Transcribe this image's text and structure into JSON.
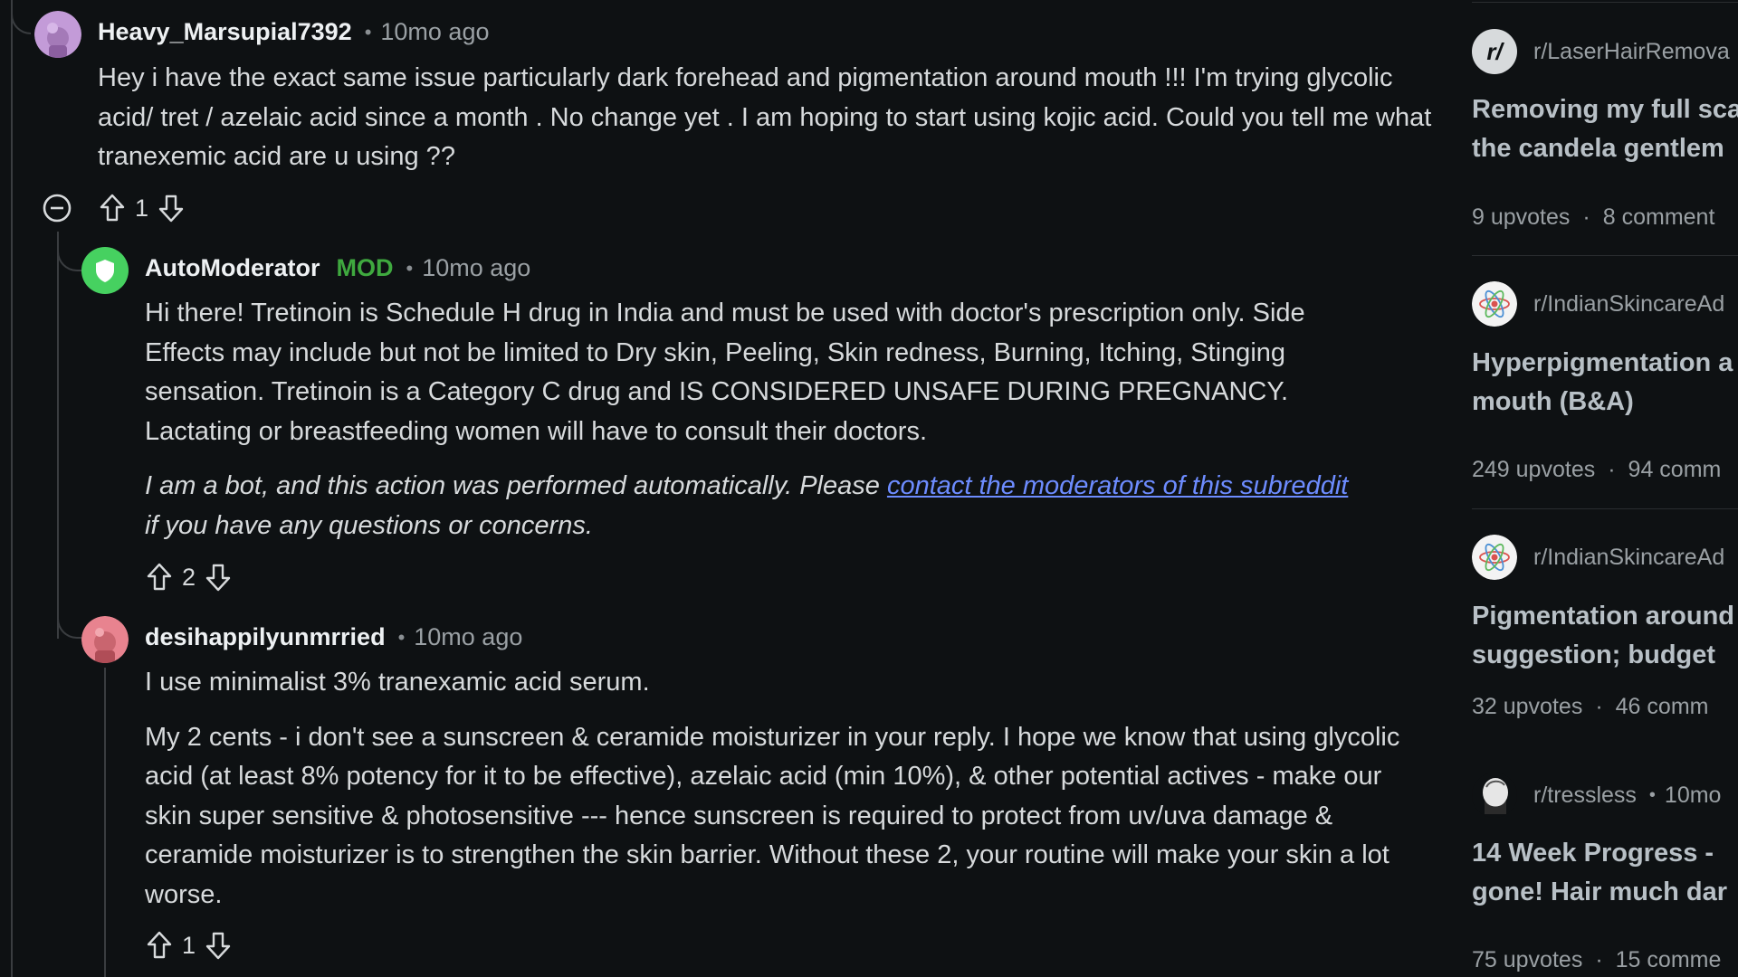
{
  "comments": [
    {
      "author": "Heavy_Marsupial7392",
      "time": "10mo ago",
      "text": "Hey i have the exact same issue particularly dark forehead and pigmentation around mouth !!! I'm trying glycolic acid/ tret / azelaic acid since a month . No change yet . I am hoping to start using kojic acid. Could you tell me what tranexemic acid are u using ??",
      "votes": "1"
    },
    {
      "author": "AutoModerator",
      "badge": "MOD",
      "time": "10mo ago",
      "text": "Hi there! Tretinoin is Schedule H drug in India and must be used with doctor's prescription only. Side Effects may include but not be limited to Dry skin, Peeling, Skin redness, Burning, Itching, Stinging sensation. Tretinoin is a Category C drug and IS CONSIDERED UNSAFE DURING PREGNANCY. Lactating or breastfeeding women will have to consult their doctors.",
      "bot_note_before": "I am a bot, and this action was performed automatically. Please ",
      "bot_link": "contact the moderators of this subreddit",
      "bot_note_after": " if you have any questions or concerns.",
      "votes": "2"
    },
    {
      "author": "desihappilyunmrried",
      "time": "10mo ago",
      "text_1": "I use minimalist 3% tranexamic acid serum.",
      "text_2": "My 2 cents - i don't see a sunscreen & ceramide moisturizer in your reply. I hope we know that using glycolic acid (at least 8% potency for it to be effective), azelaic acid (min 10%), & other potential actives - make our skin super sensitive & photosensitive --- hence sunscreen is required to protect from uv/uva damage & ceramide moisturizer is to strengthen the skin barrier. Without these 2, your routine will make your skin a lot worse.",
      "votes": "1"
    }
  ],
  "sidebar": {
    "posts": [
      {
        "subreddit": "r/LaserHairRemova",
        "title_1": "Removing my full sca",
        "title_2": "the candela gentlem",
        "upvotes": "9 upvotes",
        "comments": "8 comment"
      },
      {
        "subreddit": "r/IndianSkincareAd",
        "title_1": "Hyperpigmentation a",
        "title_2": "mouth (B&A)",
        "upvotes": "249 upvotes",
        "comments": "94 comm"
      },
      {
        "subreddit": "r/IndianSkincareAd",
        "title_1": "Pigmentation around",
        "title_2": "suggestion; budget",
        "upvotes": "32 upvotes",
        "comments": "46 comm"
      },
      {
        "subreddit": "r/tressless",
        "time": "10mo",
        "title_1": "14 Week Progress -",
        "title_2": "gone! Hair much dar",
        "upvotes": "75 upvotes",
        "comments": "15 comme"
      }
    ],
    "stat_separator": "·",
    "meta_separator": "•"
  },
  "colors": {
    "background": "#0e1113",
    "mod_badge": "#3fa93f",
    "link": "#6d8cff",
    "automod_avatar": "#46d160"
  }
}
